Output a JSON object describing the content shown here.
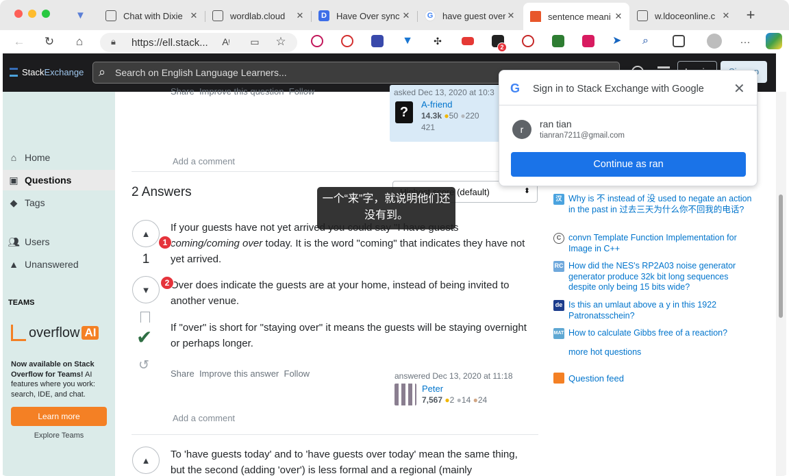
{
  "browser": {
    "tabs": [
      {
        "title": "Chat with Dixie"
      },
      {
        "title": "wordlab.cloud"
      },
      {
        "title": "Have Over sync"
      },
      {
        "title": "have guest over"
      },
      {
        "title": "sentence meani",
        "active": true
      },
      {
        "title": "w.ldoceonline.c"
      }
    ],
    "new_tab": "+",
    "close_glyph": "✕",
    "url": "https://ell.stack...",
    "extension_badge": "2",
    "more_glyph": "···"
  },
  "se_header": {
    "logo_text_1": "Stack",
    "logo_text_2": "Exchange",
    "search_placeholder": "Search on English Language Learners...",
    "login": "Log in",
    "signup": "Sign up"
  },
  "left_nav": {
    "items": [
      "Home",
      "Questions",
      "Tags",
      "Users",
      "Unanswered"
    ],
    "teams_heading": "TEAMS",
    "teams_logo_text": "overflow",
    "teams_logo_ai": "AI",
    "teams_promo_bold": "Now available on Stack Overflow for Teams!",
    "teams_promo_rest": " AI features where you work: search, IDE, and chat.",
    "learn_more": "Learn more",
    "explore_teams": "Explore Teams"
  },
  "question_footer": {
    "share": "Share",
    "improve": "Improve this question",
    "follow": "Follow",
    "asked": "asked Dec 13, 2020 at 10:3",
    "user": "A-friend",
    "rep": "14.3k",
    "gold": "50",
    "silver": "220",
    "bronze": "421",
    "add_comment": "Add a comment"
  },
  "answers": {
    "heading": "2 Answers",
    "sort_label": "Highest score (default)",
    "answer1": {
      "score": "1",
      "p1_a": "If your guests have not yet arrived you could say \"I have guests ",
      "p1_em": "coming/coming over",
      "p1_b": " today. It is the word \"coming\" that indicates they have not yet arrived.",
      "p2": "Over does indicate the guests are at your home, instead of being invited to another venue.",
      "p3": "If \"over\" is short for \"staying over\" it means the guests will be staying overnight or perhaps longer.",
      "share": "Share",
      "improve": "Improve this answer",
      "follow": "Follow",
      "answered": "answered Dec 13, 2020 at 11:18",
      "user": "Peter",
      "rep": "7,567",
      "gold": "2",
      "silver": "14",
      "bronze": "24",
      "add_comment": "Add a comment"
    },
    "answer2": {
      "p1": "To 'have guests today' and to 'have guests over today' mean the same thing, but the second (adding 'over') is less formal and a regional (mainly"
    }
  },
  "annotations": {
    "marker1": "1",
    "marker2": "2",
    "tooltip": "一个“来”字，就说明他们还没有到。"
  },
  "google_popup": {
    "title": "Sign in to Stack Exchange with Google",
    "avatar_letter": "r",
    "name": "ran tian",
    "email": "tianran7211@gmail.com",
    "button": "Continue as ran"
  },
  "hot_questions": [
    {
      "site": "汉",
      "color": "#4aa3df",
      "text": "Why is 不 instead of 没 used to negate an action in the past in 过去三天为什么你不回我的电话?"
    },
    {
      "site": "C",
      "color": "#555555",
      "text": "convn Template Function Implementation for Image in C++"
    },
    {
      "site": "RC",
      "color": "#6fa8dc",
      "text": "How did the NES's RP2A03 noise generator generator produce 32k bit long sequences despite only being 15 bits wide?"
    },
    {
      "site": "de",
      "color": "#1b3c8c",
      "text": "Is this an umlaut above a y in this 1922 Patronatsschein?"
    },
    {
      "site": "MAT",
      "color": "#5fa8d3",
      "text": "How to calculate Gibbs free of a reaction?"
    }
  ],
  "more_hot": "more hot questions",
  "question_feed": "Question feed"
}
